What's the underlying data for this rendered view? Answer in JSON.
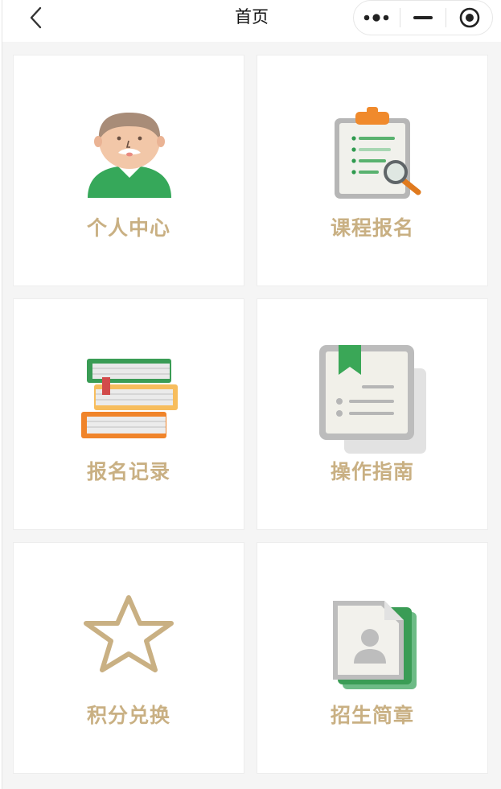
{
  "navbar": {
    "title": "首页"
  },
  "menu": [
    {
      "label": "个人中心",
      "icon": "user-avatar-icon"
    },
    {
      "label": "课程报名",
      "icon": "clipboard-search-icon"
    },
    {
      "label": "报名记录",
      "icon": "book-stack-icon"
    },
    {
      "label": "操作指南",
      "icon": "guide-book-icon"
    },
    {
      "label": "积分兑换",
      "icon": "star-icon"
    },
    {
      "label": "招生简章",
      "icon": "brochure-icon"
    }
  ],
  "colors": {
    "label": "#c9b083",
    "green": "#3aa757",
    "orange": "#f08a2c"
  }
}
